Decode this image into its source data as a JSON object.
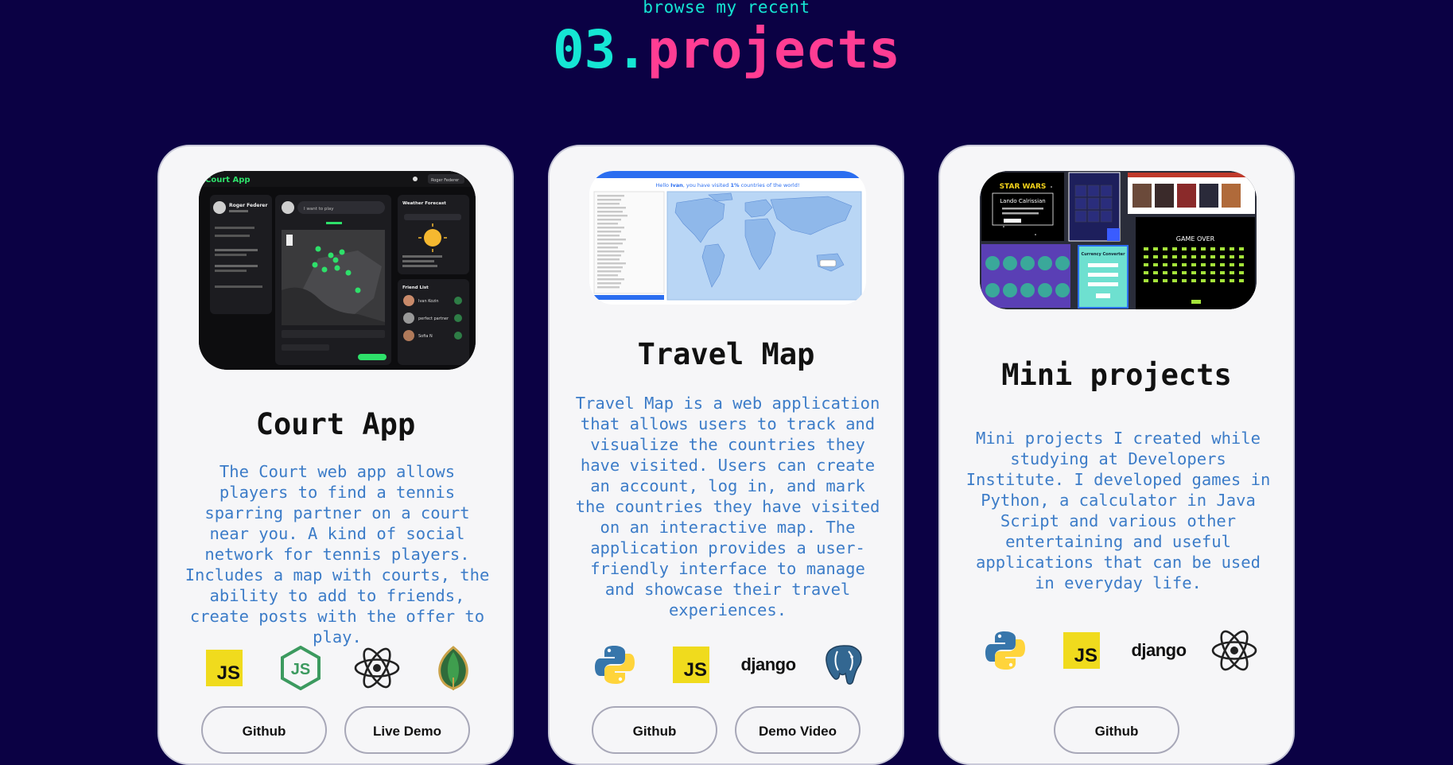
{
  "section": {
    "eyebrow": "browse my recent",
    "number": "03.",
    "title": "projects"
  },
  "colors": {
    "background": "#0b0144",
    "accent_teal": "#15e6d4",
    "accent_pink": "#ff3d93",
    "card_bg": "#f6f6f8",
    "desc_blue": "#3c7cc8"
  },
  "cards": [
    {
      "title": "Court App",
      "description": "The Court web app allows players to find a tennis sparring partner on a court near you. A kind of social network for tennis players. Includes a map with courts, the ability to add to friends, create posts with the offer to play.",
      "icons": [
        "javascript-icon",
        "nodejs-icon",
        "react-icon",
        "mongodb-icon"
      ],
      "buttons": [
        "Github",
        "Live Demo"
      ],
      "screenshot": {
        "app_title": "Court App",
        "user_name": "Roger Federer",
        "post_placeholder": "I want to play",
        "weather_label": "Weather Forecast",
        "friend_list_label": "Friend List",
        "friends": [
          "Ivan Kozin",
          "perfect partner",
          "Sofia N"
        ],
        "header_user": "Roger Federer"
      }
    },
    {
      "title": "Travel Map",
      "description": "Travel Map is a web application that allows users to track and visualize the countries they have visited. Users can create an account, log in, and mark the countries they have visited on an interactive map. The application provides a user-friendly interface to manage and showcase their travel experiences.",
      "icons": [
        "python-icon",
        "javascript-icon",
        "django-icon",
        "postgresql-icon"
      ],
      "buttons": [
        "Github",
        "Demo Video"
      ],
      "screenshot": {
        "greeting_prefix": "Hello ",
        "greeting_name": "Ivan",
        "greeting_mid": ", you have visited ",
        "greeting_pct": "1%",
        "greeting_suffix": " countries of the world!"
      }
    },
    {
      "title": "Mini projects",
      "description": "Mini projects I created while studying at Developers Institute. I developed games in Python, a calculator in Java Script and various other entertaining and useful applications that can be used in everyday life.",
      "icons": [
        "python-icon",
        "javascript-icon",
        "django-icon",
        "react-icon"
      ],
      "buttons": [
        "Github"
      ],
      "screenshot": {
        "starwars_logo": "STAR WARS",
        "character": "Lando Calrissian",
        "converter_title": "Currency Converter",
        "game_over": "GAME OVER"
      }
    }
  ],
  "icon_text": {
    "js": "JS",
    "django": "django"
  }
}
